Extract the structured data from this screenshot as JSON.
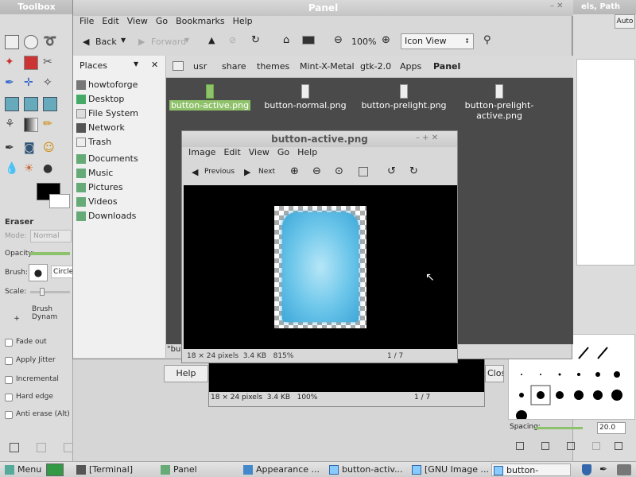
{
  "toolbox": {
    "title": "Toolbox",
    "tool_options": {
      "tool_name": "Eraser",
      "mode_label": "Mode:",
      "mode_value": "Normal",
      "opacity_label": "Opacity:",
      "brush_label": "Brush:",
      "brush_value": "Circle",
      "scale_label": "Scale:",
      "brush_dynamics_label": "Brush Dynam",
      "checkboxes": [
        "Fade out",
        "Apply Jitter",
        "Incremental",
        "Hard edge",
        "Anti erase  (Alt)"
      ]
    }
  },
  "right_panel": {
    "top_title": "els, Path",
    "auto_button": "Auto",
    "spacing_label": "Spacing:",
    "spacing_value": "20.0"
  },
  "file_manager": {
    "title": "Panel",
    "menu": [
      "File",
      "Edit",
      "View",
      "Go",
      "Bookmarks",
      "Help"
    ],
    "toolbar": {
      "back": "Back",
      "forward": "Forward",
      "zoom": "100%",
      "view_mode": "Icon View"
    },
    "sidebar": {
      "header": "Places",
      "items": [
        "howtoforge",
        "Desktop",
        "File System",
        "Network",
        "Trash",
        "Documents",
        "Music",
        "Pictures",
        "Videos",
        "Downloads"
      ]
    },
    "path": [
      "usr",
      "share",
      "themes",
      "Mint-X-Metal",
      "gtk-2.0",
      "Apps",
      "Panel"
    ],
    "files": [
      {
        "name": "button-active.png"
      },
      {
        "name": "button-normal.png"
      },
      {
        "name": "button-prelight.png"
      },
      {
        "name": "button-prelight-active.png"
      }
    ],
    "status_fragment": "\"bu"
  },
  "viewer": {
    "title": "button-active.png",
    "menu": [
      "Image",
      "Edit",
      "View",
      "Go",
      "Help"
    ],
    "previous": "Previous",
    "next": "Next",
    "status_dims": "18 × 24 pixels",
    "status_size": "3.4 KB",
    "status_zoom": "815%",
    "status_index": "1 / 7"
  },
  "viewer_back": {
    "status_dims": "18 × 24 pixels",
    "status_size": "3.4 KB",
    "status_zoom": "100%",
    "status_index": "1 / 7",
    "help_button": "Help",
    "close_button": "Clos"
  },
  "taskbar": {
    "menu": "Menu",
    "tasks": [
      "[Terminal]",
      "Panel",
      "Appearance ...",
      "button-activ...",
      "[GNU Image ...",
      "button-active..."
    ]
  },
  "colors": {
    "selection_green": "#8fc26b",
    "dark_view": "#4a4a4a",
    "image_blue": "#5ab8e0"
  }
}
